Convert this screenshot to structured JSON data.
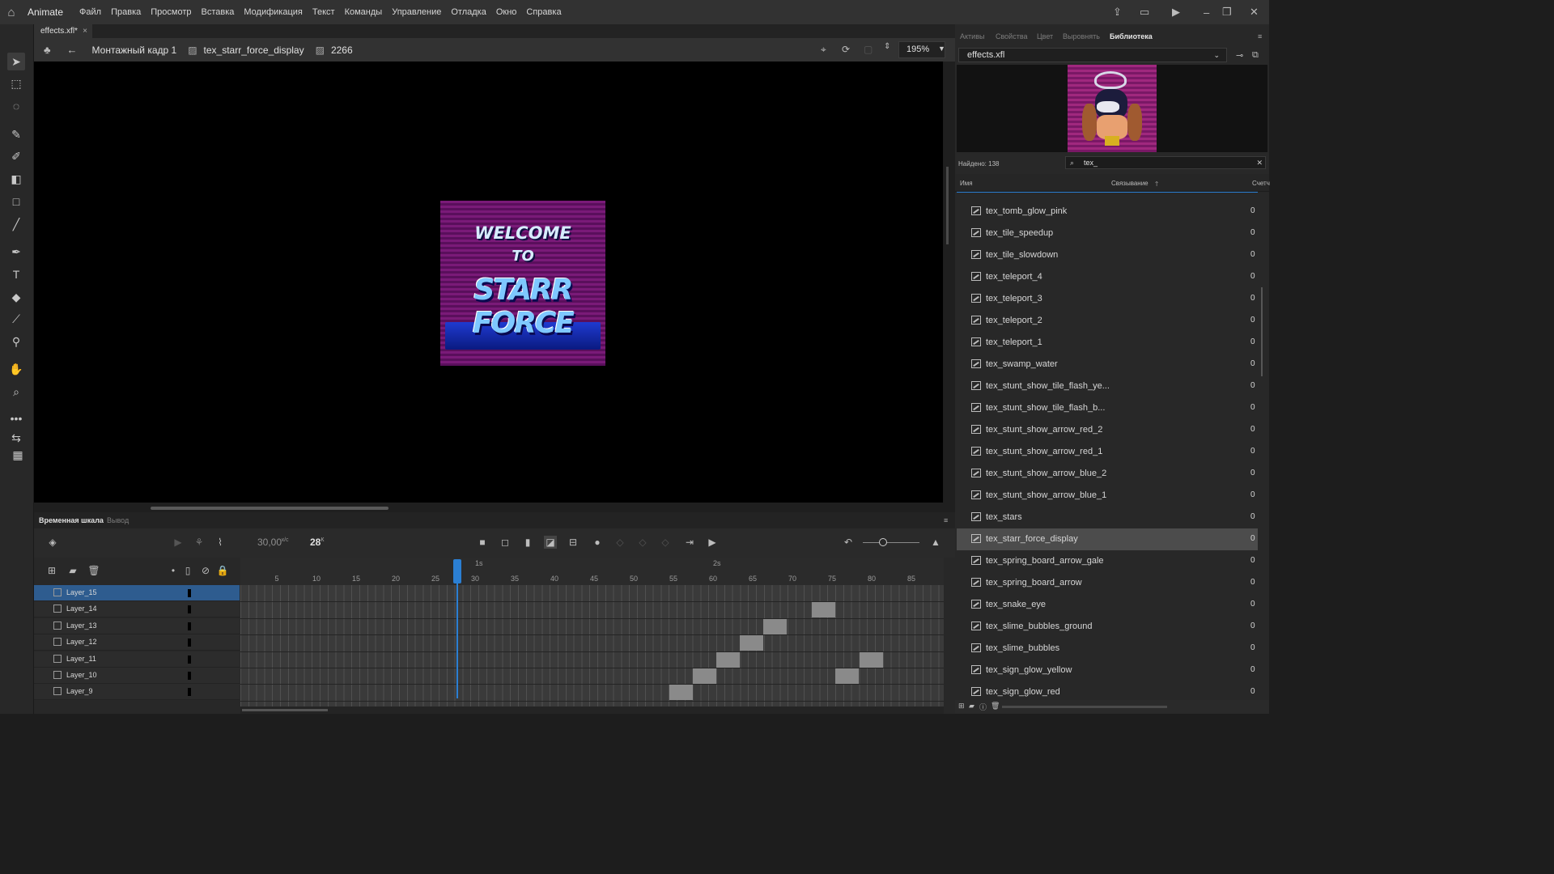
{
  "app": {
    "name": "Animate",
    "menu": [
      "Файл",
      "Правка",
      "Просмотр",
      "Вставка",
      "Модификация",
      "Текст",
      "Команды",
      "Управление",
      "Отладка",
      "Окно",
      "Справка"
    ]
  },
  "document": {
    "tab_title": "effects.xfl*",
    "tab_close": "×"
  },
  "editbar": {
    "scene": "Монтажный кадр 1",
    "symbol": "tex_starr_force_display",
    "frame_value": "2266",
    "zoom": "195%"
  },
  "stage": {
    "art_line1": "WELCOME",
    "art_line2": "TO",
    "art_line3": "STARR FORCE"
  },
  "timeline": {
    "tabs": [
      "Временная шкала",
      "Вывод"
    ],
    "fps": "30,00",
    "fps_unit": "к/с",
    "current_frame": "28",
    "current_frame_unit": "К",
    "ruler_numbers": [
      "5",
      "10",
      "15",
      "20",
      "25",
      "30",
      "35",
      "40",
      "45",
      "50",
      "55",
      "60",
      "65",
      "70",
      "75",
      "80",
      "85"
    ],
    "ruler_seconds": [
      "1s",
      "2s"
    ],
    "layers": [
      {
        "name": "Layer_15",
        "selected": true
      },
      {
        "name": "Layer_14",
        "selected": false
      },
      {
        "name": "Layer_13",
        "selected": false
      },
      {
        "name": "Layer_12",
        "selected": false
      },
      {
        "name": "Layer_11",
        "selected": false
      },
      {
        "name": "Layer_10",
        "selected": false
      },
      {
        "name": "Layer_9",
        "selected": false
      }
    ]
  },
  "library": {
    "panel_tabs": [
      "Активы",
      "Свойства",
      "Цвет",
      "Выровнять",
      "Библиотека"
    ],
    "active_tab": "Библиотека",
    "selected_file": "effects.xfl",
    "found_text": "Найдено: 138",
    "search_value": "tex_",
    "columns": {
      "name": "Имя",
      "linkage": "Связывание",
      "count": "Счетч"
    },
    "items": [
      {
        "name": "tex_tomb_glow_pink",
        "count": "0",
        "selected": false
      },
      {
        "name": "tex_tile_speedup",
        "count": "0",
        "selected": false
      },
      {
        "name": "tex_tile_slowdown",
        "count": "0",
        "selected": false
      },
      {
        "name": "tex_teleport_4",
        "count": "0",
        "selected": false
      },
      {
        "name": "tex_teleport_3",
        "count": "0",
        "selected": false
      },
      {
        "name": "tex_teleport_2",
        "count": "0",
        "selected": false
      },
      {
        "name": "tex_teleport_1",
        "count": "0",
        "selected": false
      },
      {
        "name": "tex_swamp_water",
        "count": "0",
        "selected": false
      },
      {
        "name": "tex_stunt_show_tile_flash_ye...",
        "count": "0",
        "selected": false
      },
      {
        "name": "tex_stunt_show_tile_flash_b...",
        "count": "0",
        "selected": false
      },
      {
        "name": "tex_stunt_show_arrow_red_2",
        "count": "0",
        "selected": false
      },
      {
        "name": "tex_stunt_show_arrow_red_1",
        "count": "0",
        "selected": false
      },
      {
        "name": "tex_stunt_show_arrow_blue_2",
        "count": "0",
        "selected": false
      },
      {
        "name": "tex_stunt_show_arrow_blue_1",
        "count": "0",
        "selected": false
      },
      {
        "name": "tex_stars",
        "count": "0",
        "selected": false
      },
      {
        "name": "tex_starr_force_display",
        "count": "0",
        "selected": true
      },
      {
        "name": "tex_spring_board_arrow_gale",
        "count": "0",
        "selected": false
      },
      {
        "name": "tex_spring_board_arrow",
        "count": "0",
        "selected": false
      },
      {
        "name": "tex_snake_eye",
        "count": "0",
        "selected": false
      },
      {
        "name": "tex_slime_bubbles_ground",
        "count": "0",
        "selected": false
      },
      {
        "name": "tex_slime_bubbles",
        "count": "0",
        "selected": false
      },
      {
        "name": "tex_sign_glow_yellow",
        "count": "0",
        "selected": false
      },
      {
        "name": "tex_sign_glow_red",
        "count": "0",
        "selected": false
      }
    ]
  }
}
